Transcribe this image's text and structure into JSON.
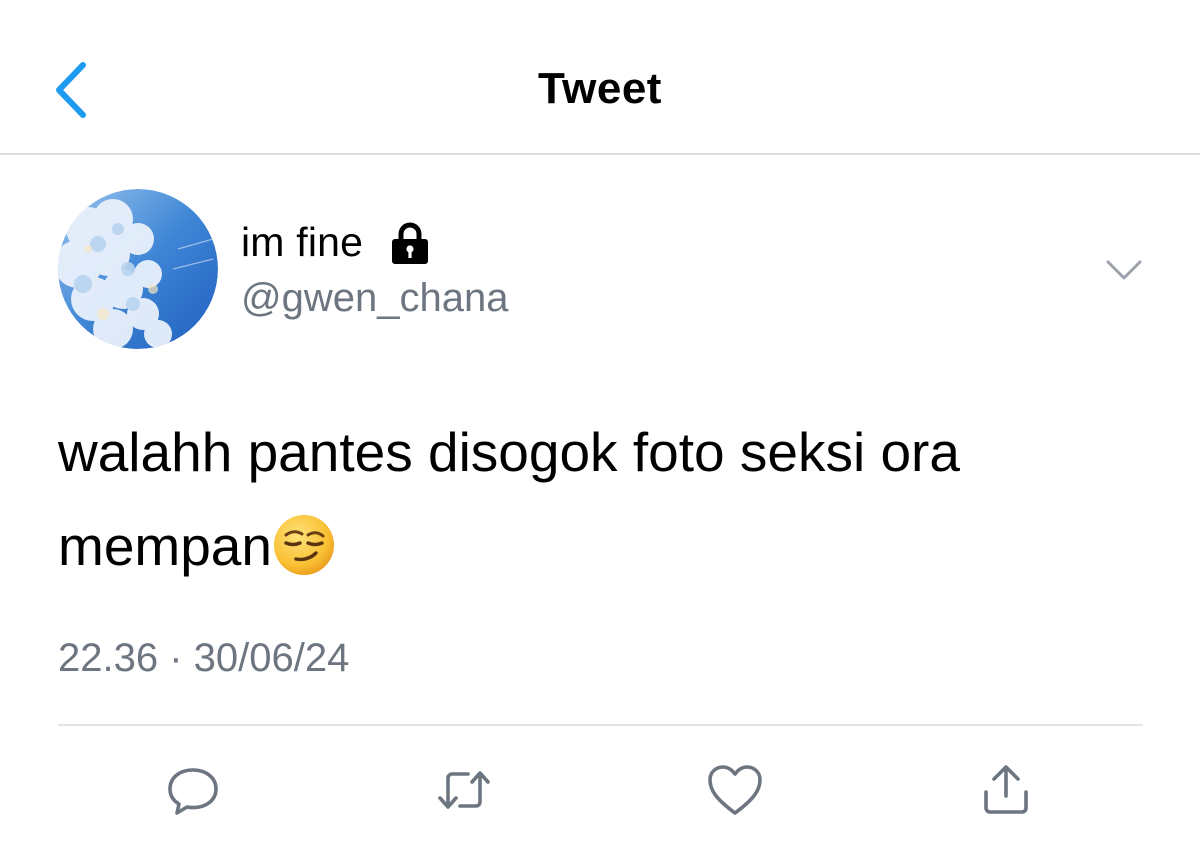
{
  "nav": {
    "title": "Tweet"
  },
  "author": {
    "display_name": "im fine",
    "handle": "@gwen_chana",
    "protected": true
  },
  "tweet": {
    "text": "walahh pantes disogok foto seksi ora mempan",
    "emoji": "smirking-face",
    "timestamp": "22.36 · 30/06/24"
  },
  "colors": {
    "accent": "#1d9bf0",
    "secondary_text": "#6d7680",
    "icon": "#6d7680"
  },
  "icons": [
    "back-icon",
    "lock-icon",
    "chevron-down-icon",
    "reply-icon",
    "retweet-icon",
    "like-icon",
    "share-icon"
  ]
}
